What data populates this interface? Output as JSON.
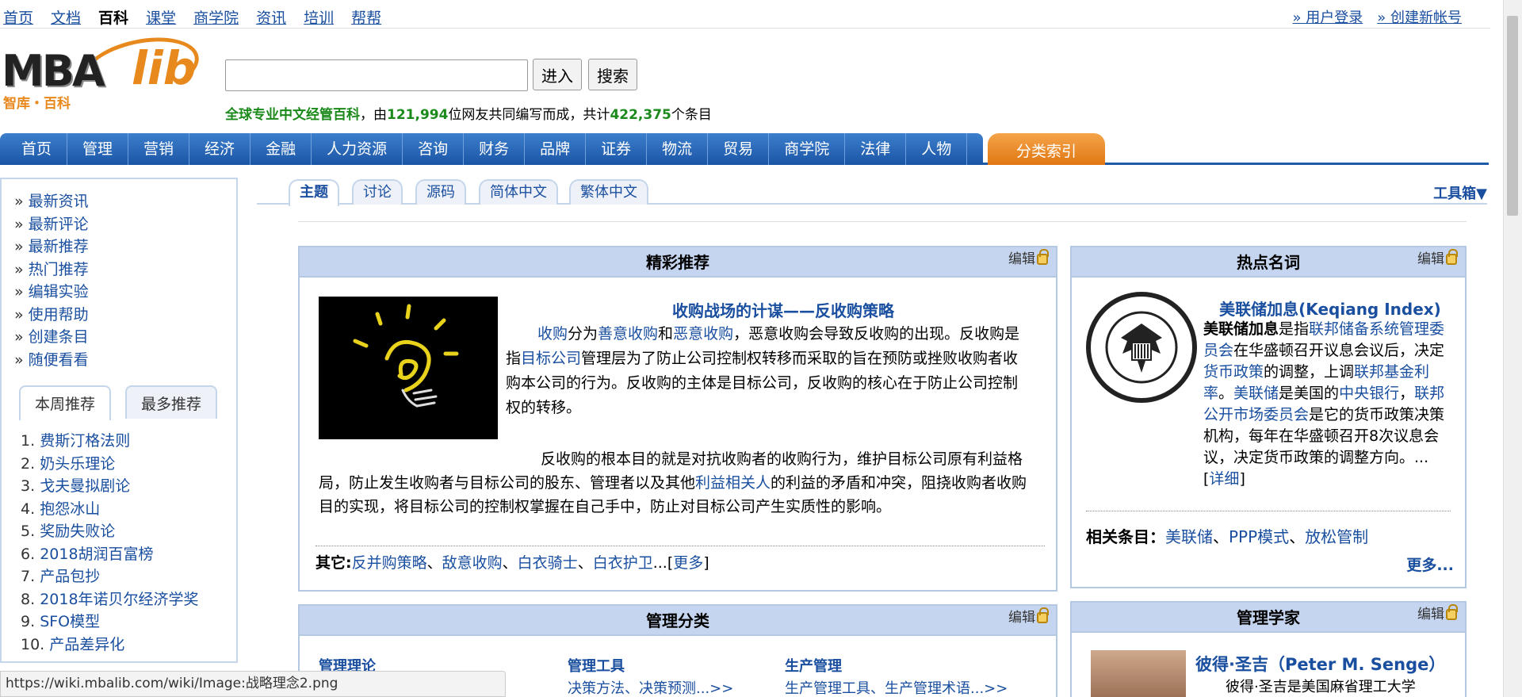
{
  "topnav": [
    "首页",
    "文档",
    "百科",
    "课堂",
    "商学院",
    "资讯",
    "培训",
    "帮帮"
  ],
  "topnav_current": "百科",
  "userlinks": [
    "» 用户登录",
    "» 创建新帐号"
  ],
  "logo": {
    "brand": "MBA",
    "lib": "lib",
    "sub": "智库・百科"
  },
  "search": {
    "value": "",
    "enter": "进入",
    "search": "搜索"
  },
  "tagline": {
    "a": "全球专业中文经管百科",
    "b": "，由",
    "n1": "121,994",
    "c": "位网友共同编写而成，共计",
    "n2": "422,375",
    "d": "个条目"
  },
  "mainnav": [
    "首页",
    "管理",
    "营销",
    "经济",
    "金融",
    "人力资源",
    "咨询",
    "财务",
    "品牌",
    "证券",
    "物流",
    "贸易",
    "商学院",
    "法律",
    "人物"
  ],
  "catindex": "分类索引",
  "sidelinks": [
    "最新资讯",
    "最新评论",
    "最新推荐",
    "热门推荐",
    "编辑实验",
    "使用帮助",
    "创建条目",
    "随便看看"
  ],
  "sidetabs": [
    "本周推荐",
    "最多推荐"
  ],
  "ranklist": [
    {
      "n": "1.",
      "t": "费斯汀格法则"
    },
    {
      "n": "2.",
      "t": "奶头乐理论"
    },
    {
      "n": "3.",
      "t": "戈夫曼拟剧论"
    },
    {
      "n": "4.",
      "t": "抱怨冰山"
    },
    {
      "n": "5.",
      "t": "奖励失败论"
    },
    {
      "n": "6.",
      "t": "2018胡润百富榜"
    },
    {
      "n": "7.",
      "t": "产品包抄"
    },
    {
      "n": "8.",
      "t": "2018年诺贝尔经济学奖"
    },
    {
      "n": "9.",
      "t": "SFO模型"
    },
    {
      "n": "10.",
      "t": "产品差异化"
    }
  ],
  "ctabs": [
    "主题",
    "讨论",
    "源码",
    "简体中文",
    "繁体中文"
  ],
  "toolbox": "工具箱▼",
  "edit": "编辑",
  "feat": {
    "header": "精彩推荐",
    "title": "收购战场的计谋——反收购策略",
    "p1": [
      {
        "t": "收购",
        "l": true
      },
      {
        "t": "分为"
      },
      {
        "t": "善意收购",
        "l": true
      },
      {
        "t": "和"
      },
      {
        "t": "恶意收购",
        "l": true
      },
      {
        "t": "，恶意收购会导致反收购的出现。反收购是指"
      },
      {
        "t": "目标公司",
        "l": true
      },
      {
        "t": "管理层为了防止公司控制权转移而采取的旨在预防或挫败收购者收购本公司的行为。反收购的主体是目标公司，反收购的核心在于防止公司控制权的转移。"
      }
    ],
    "p2": [
      {
        "t": "反收购的根本目的就是对抗收购者的收购行为，维护目标公司原有利益格局，防止发生收购者与目标公司的股东、管理者以及其他"
      },
      {
        "t": "利益相关人",
        "l": true
      },
      {
        "t": "的利益的矛盾和冲突，阻挠收购者收购目的实现，将目标公司的控制权掌握在自己手中，防止对目标公司产生实质性的影响。"
      }
    ],
    "more_label": "其它:",
    "more_links": [
      {
        "t": "反并购策略",
        "l": true
      },
      {
        "t": "、"
      },
      {
        "t": "敌意收购",
        "l": true
      },
      {
        "t": "、"
      },
      {
        "t": "白衣骑士",
        "l": true
      },
      {
        "t": "、"
      },
      {
        "t": "白衣护卫",
        "l": true
      },
      {
        "t": "...["
      },
      {
        "t": "更多",
        "l": true
      },
      {
        "t": "]"
      }
    ]
  },
  "hot": {
    "header": "热点名词",
    "title": "美联储加息(Keqiang Index)",
    "p": [
      {
        "t": "美联储加息",
        "b": true
      },
      {
        "t": "是指"
      },
      {
        "t": "联邦储备系统管理委员会",
        "l": true
      },
      {
        "t": "在华盛顿召开议息会议后，决定"
      },
      {
        "t": "货币政策",
        "l": true
      },
      {
        "t": "的调整，上调"
      },
      {
        "t": "联邦基金利率",
        "l": true
      },
      {
        "t": "。"
      },
      {
        "t": "美联储",
        "l": true
      },
      {
        "t": "是美国的"
      },
      {
        "t": "中央银行",
        "l": true
      },
      {
        "t": "，"
      },
      {
        "t": "联邦公开市场委员会",
        "l": true
      },
      {
        "t": "是它的货币政策决策机构，每年在华盛顿召开8次议息会议，决定货币政策的调整方向。...["
      },
      {
        "t": "详细",
        "l": true
      },
      {
        "t": "]"
      }
    ],
    "rel_label": "相关条目：",
    "rel": [
      {
        "t": "美联储",
        "l": true
      },
      {
        "t": "、"
      },
      {
        "t": "PPP模式",
        "l": true
      },
      {
        "t": "、"
      },
      {
        "t": "放松管制",
        "l": true
      }
    ],
    "more": "更多..."
  },
  "cat": {
    "header": "管理分类",
    "cols": [
      {
        "h": "管理理论",
        "s": ""
      },
      {
        "h": "管理工具",
        "s": "决策方法、决策预测...>>"
      },
      {
        "h": "生产管理",
        "s": "生产管理工具、生产管理术语...>>"
      }
    ]
  },
  "scholar": {
    "header": "管理学家",
    "name": "彼得·圣吉（Peter M. Senge）",
    "text": "彼得·圣吉是美国麻省理工大学"
  },
  "status": "https://wiki.mbalib.com/wiki/Image:战略理念2.png"
}
